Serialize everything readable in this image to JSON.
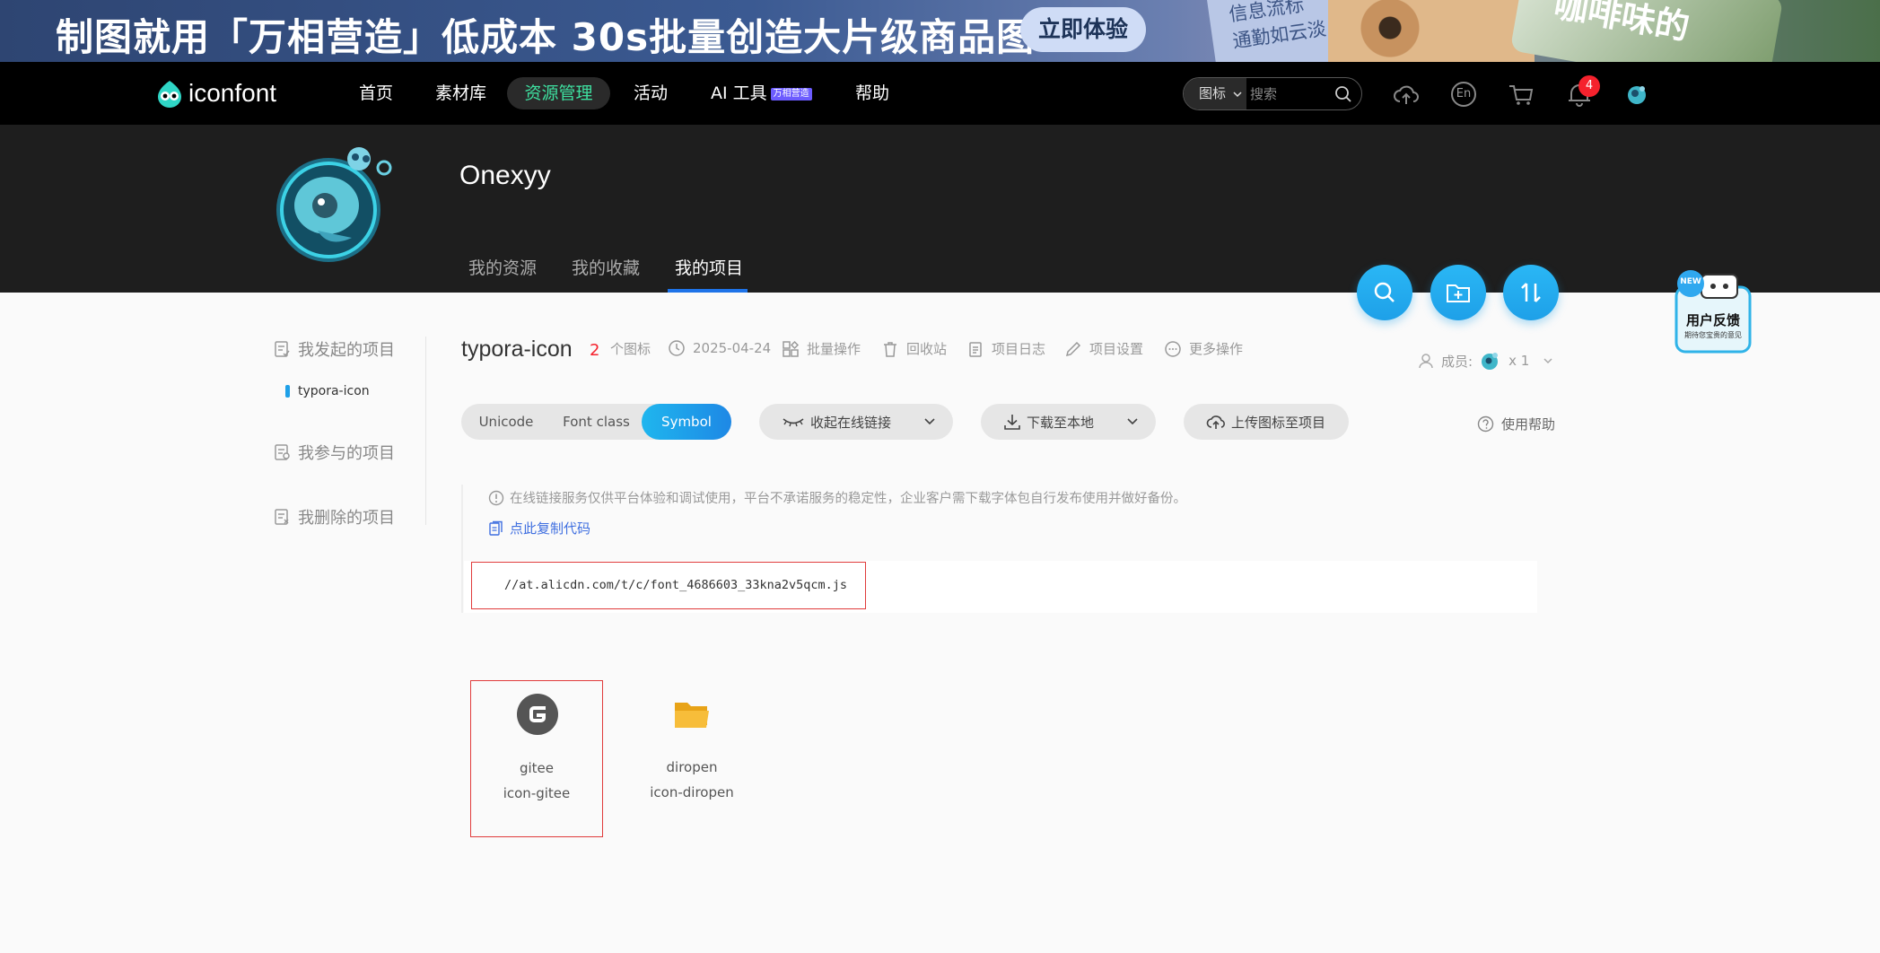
{
  "banner": {
    "headline": "制图就用「万相营造」低成本 30s批量创造大片级商品图",
    "cta_label": "立即体验",
    "card1_line1": "信息流标",
    "card1_line2": "通勤如云淡",
    "card2_text": "咖啡味的"
  },
  "nav": {
    "logo_text": "iconfont",
    "items": [
      "首页",
      "素材库",
      "资源管理",
      "活动",
      "AI 工具",
      "帮助"
    ],
    "ai_badge": "万相营造",
    "search_type": "图标",
    "search_placeholder": "搜索",
    "notification_count": "4",
    "lang_label": "En"
  },
  "profile": {
    "username": "Onexyy",
    "tabs": [
      "我的资源",
      "我的收藏",
      "我的项目"
    ],
    "active_tab": "我的项目"
  },
  "sidebar": {
    "started": "我发起的项目",
    "current_project": "typora-icon",
    "joined": "我参与的项目",
    "deleted": "我删除的项目"
  },
  "project": {
    "name": "typora-icon",
    "icon_count": "2",
    "icon_count_label": "个图标",
    "date": "2025-04-24",
    "actions": [
      "批量操作",
      "回收站",
      "项目日志",
      "项目设置",
      "更多操作"
    ],
    "members_label": "成员:",
    "members_count": "x 1"
  },
  "toolbar": {
    "formats": [
      "Unicode",
      "Font class",
      "Symbol"
    ],
    "active_format": "Symbol",
    "collapse_link": "收起在线链接",
    "download": "下载至本地",
    "upload": "上传图标至项目",
    "help": "使用帮助"
  },
  "notice": {
    "text": "在线链接服务仅供平台体验和调试使用，平台不承诺服务的稳定性，企业客户需下载字体包自行发布使用并做好备份。",
    "copy_code": "点此复制代码",
    "url": "//at.alicdn.com/t/c/font_4686603_33kna2v5qcm.js"
  },
  "feedback": {
    "new_tag": "NEW",
    "title": "用户反馈",
    "subtitle": "期待您宝贵的意见"
  },
  "icons": [
    {
      "name": "gitee",
      "code": "icon-gitee",
      "icon": "gitee-icon",
      "color": "#555555"
    },
    {
      "name": "diropen",
      "code": "icon-diropen",
      "icon": "folder-open-icon",
      "color": "#f5b324"
    }
  ],
  "colors": {
    "accent": "#1ea0e8",
    "active_nav": "#3ee0a0",
    "count_red": "#f5222d",
    "selection_red": "#e03b3b"
  }
}
